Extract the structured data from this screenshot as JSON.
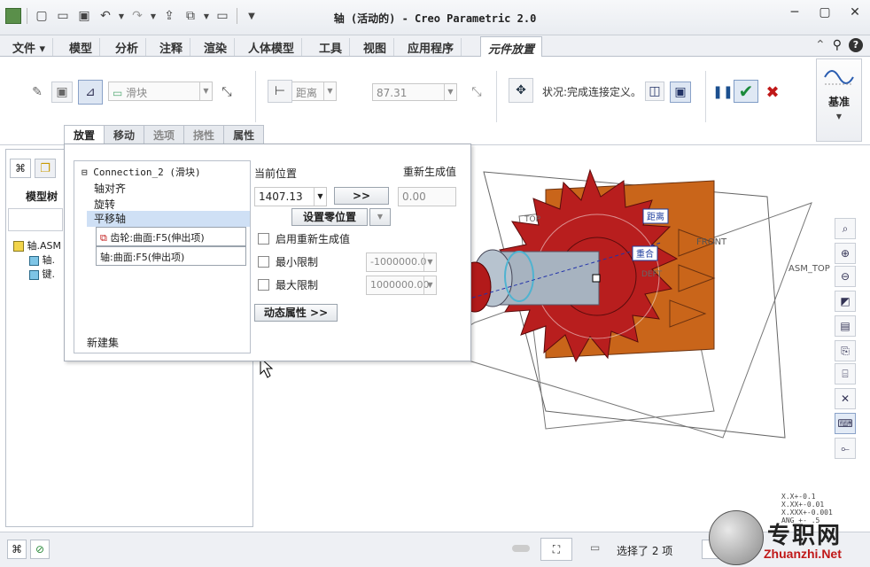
{
  "window": {
    "title": "轴 (活动的) - Creo Parametric 2.0"
  },
  "menu_tabs": [
    "文件",
    "模型",
    "分析",
    "注释",
    "渲染",
    "人体模型",
    "工具",
    "视图",
    "应用程序",
    "元件放置"
  ],
  "ribbon": {
    "constraint_type": "滑块",
    "distance_label": "距离",
    "distance_value": "87.31",
    "status_text": "状况:完成连接定义。",
    "datum_label": "基准"
  },
  "sub_tabs": [
    "放置",
    "移动",
    "选项",
    "挠性",
    "属性"
  ],
  "model_tree": {
    "header": "模型树",
    "root": "轴.ASM",
    "children": [
      "轴.",
      "键."
    ]
  },
  "placement": {
    "connection": "Connection_2 (滑块)",
    "items": [
      "轴对齐",
      "旋转",
      "平移轴"
    ],
    "ref1": "齿轮:曲面:F5(伸出项)",
    "ref2": "轴:曲面:F5(伸出项)",
    "new_set": "新建集",
    "current_pos_label": "当前位置",
    "regen_label": "重新生成值",
    "current_pos_value": "1407.13",
    "arrow_btn": ">>",
    "regen_value": "0.00",
    "set_zero_btn": "设置零位置",
    "enable_regen": "启用重新生成值",
    "min_limit": "最小限制",
    "min_value": "-1000000.0",
    "max_limit": "最大限制",
    "max_value": "1000000.00",
    "dynamic_props": "动态属性 >>"
  },
  "viewport": {
    "labels": [
      "距离",
      "重合",
      "FRONT",
      "ASM_TOP",
      "TOP",
      "DEFT"
    ]
  },
  "status": {
    "selection": "选择了 2 项",
    "tolerance": [
      "X.X+-0.1",
      "X.XX+-0.01",
      "X.XXX+-0.001",
      "ANG +- .5"
    ]
  },
  "watermark": {
    "cn": "专职网",
    "url": "Zhuanzhi.Net"
  }
}
